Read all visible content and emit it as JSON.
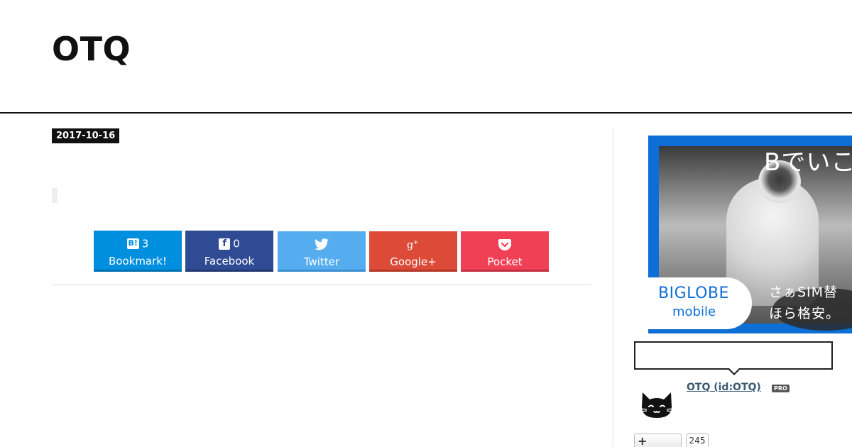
{
  "header": {
    "blog_title": "OTQ"
  },
  "entry": {
    "date": "2017-10-16"
  },
  "share_buttons": {
    "hatena": {
      "count": "3",
      "label": "Bookmark!",
      "icon": "hatena-bookmark-icon",
      "color": "#008fde"
    },
    "facebook": {
      "count": "0",
      "label": "Facebook",
      "icon": "facebook-icon",
      "color": "#2f4b93"
    },
    "twitter": {
      "label": "Twitter",
      "icon": "twitter-bird-icon",
      "color": "#55acee"
    },
    "google": {
      "label": "Google+",
      "icon": "google-plus-icon",
      "color": "#dc4a38"
    },
    "pocket": {
      "label": "Pocket",
      "icon": "pocket-icon",
      "color": "#ef4056"
    }
  },
  "sidebar": {
    "ad": {
      "headline": "Bでいこ",
      "logo_main": "BIGLOBE",
      "logo_sub": "mobile",
      "copy_line1": "さぁSIM替",
      "copy_line2": "ほら格安。",
      "brand_color": "#0d6fd6"
    },
    "profile": {
      "name": "OTQ (id:OTQ)",
      "badge": "PRO",
      "follow_icon": "plus-icon",
      "follower_count": "245"
    }
  }
}
